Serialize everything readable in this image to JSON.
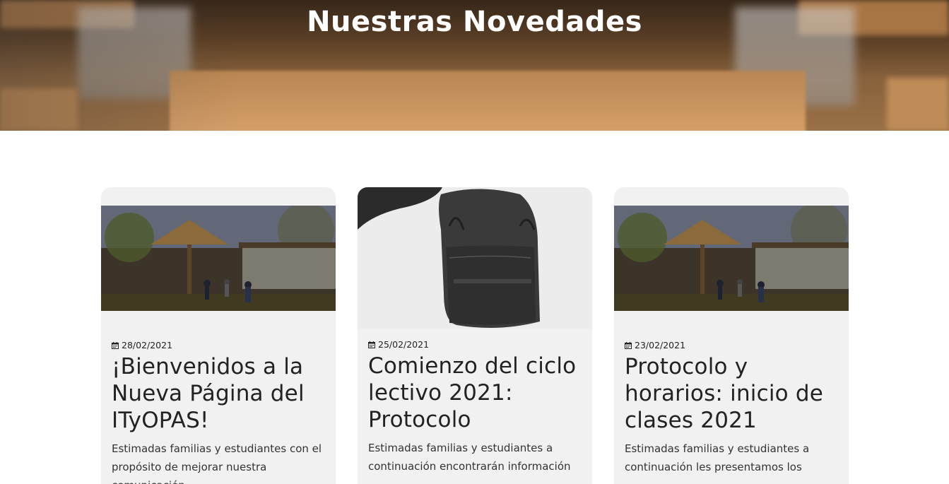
{
  "hero": {
    "title": "Nuestras Novedades"
  },
  "posts": [
    {
      "date": "28/02/2021",
      "title": "¡Bienvenidos a la Nueva Página del ITyOPAS!",
      "excerpt": "Estimadas familias y estudiantes con el propósito de mejorar nuestra comunicación"
    },
    {
      "date": "25/02/2021",
      "title": "Comienzo del ciclo lectivo 2021: Protocolo",
      "excerpt": "Estimadas familias y estudiantes a continuación encontrarán información"
    },
    {
      "date": "23/02/2021",
      "title": "Protocolo y horarios: inicio de clases 2021",
      "excerpt": "Estimadas familias y estudiantes a continuación les presentamos los"
    }
  ],
  "icons": {
    "date": "calendar-icon"
  }
}
